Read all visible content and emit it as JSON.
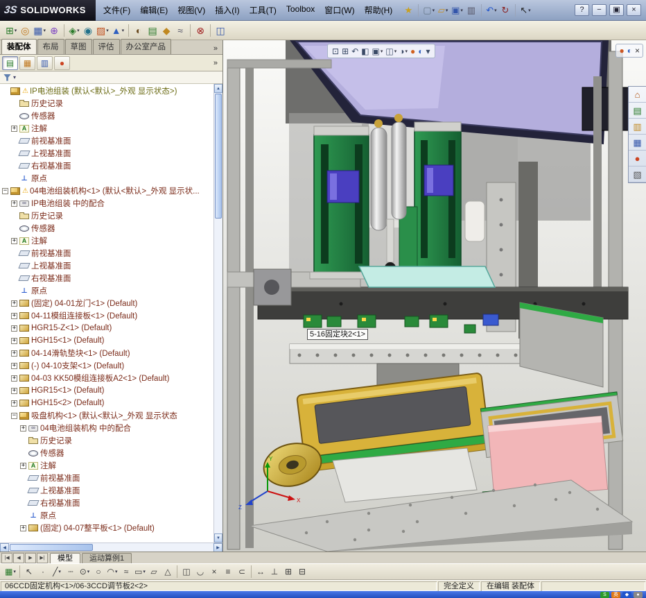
{
  "window": {
    "logo_mark": "3S",
    "logo_text": "SOLIDWORKS",
    "controls": [
      {
        "name": "help-button",
        "glyph": "?"
      },
      {
        "name": "minimize-button",
        "glyph": "−"
      },
      {
        "name": "restore-button",
        "glyph": "▣"
      },
      {
        "name": "close-button",
        "glyph": "×"
      }
    ]
  },
  "menubar": {
    "items": [
      "文件(F)",
      "编辑(E)",
      "视图(V)",
      "插入(I)",
      "工具(T)",
      "Toolbox",
      "窗口(W)",
      "帮助(H)"
    ]
  },
  "toolbar_main": {
    "icons": [
      {
        "name": "pin-icon",
        "glyph": "★",
        "color": "#c8a020"
      },
      {
        "sep": true
      },
      {
        "name": "new-document-icon",
        "glyph": "▢",
        "color": "#667788",
        "caret": true
      },
      {
        "name": "open-icon",
        "glyph": "▱",
        "color": "#c89020",
        "caret": true
      },
      {
        "name": "save-icon",
        "glyph": "▣",
        "color": "#3355aa",
        "caret": true
      },
      {
        "name": "print-icon",
        "glyph": "▥",
        "color": "#555566"
      },
      {
        "sep": true
      },
      {
        "name": "undo-icon",
        "glyph": "↶",
        "color": "#2255cc",
        "caret": true
      },
      {
        "name": "rebuild-icon",
        "glyph": "↻",
        "color": "#8a2020"
      },
      {
        "sep": true
      },
      {
        "name": "select-icon",
        "glyph": "↖",
        "color": "#222222",
        "caret": true
      }
    ]
  },
  "toolbar_assembly": {
    "icons": [
      {
        "name": "insert-components-icon",
        "glyph": "⊞",
        "color": "#2a7a2a",
        "caret": true
      },
      {
        "name": "mate-icon",
        "glyph": "◎",
        "color": "#c07820"
      },
      {
        "name": "linear-component-pattern-icon",
        "glyph": "▦",
        "color": "#3355aa",
        "caret": true
      },
      {
        "name": "smart-fasteners-icon",
        "glyph": "⊕",
        "color": "#7a3fc0"
      },
      {
        "sep": true
      },
      {
        "name": "move-component-icon",
        "glyph": "◈",
        "color": "#2a7a2a",
        "caret": true
      },
      {
        "name": "show-hidden-components-icon",
        "glyph": "◉",
        "color": "#20708a"
      },
      {
        "name": "assembly-features-icon",
        "glyph": "▨",
        "color": "#c05020",
        "caret": true
      },
      {
        "name": "reference-geometry-icon",
        "glyph": "▲",
        "color": "#3060c0",
        "caret": true
      },
      {
        "sep": true
      },
      {
        "name": "new-motion-study-icon",
        "glyph": "◐",
        "color": "#6a4a20"
      },
      {
        "name": "bill-of-materials-icon",
        "glyph": "▤",
        "color": "#2a7a2a"
      },
      {
        "name": "exploded-view-icon",
        "glyph": "◆",
        "color": "#c08820"
      },
      {
        "name": "explode-line-sketch-icon",
        "glyph": "≈",
        "color": "#555566"
      },
      {
        "sep": true
      },
      {
        "name": "interference-detection-icon",
        "glyph": "⊗",
        "color": "#a02020"
      },
      {
        "sep": true
      },
      {
        "name": "window-select-icon",
        "glyph": "◫",
        "color": "#3355aa"
      }
    ]
  },
  "left_panel": {
    "tabs": [
      {
        "label": "装配体",
        "active": true
      },
      {
        "label": "布局"
      },
      {
        "label": "草图"
      },
      {
        "label": "评估"
      },
      {
        "label": "办公室产品"
      }
    ],
    "tabs_overflow": "»",
    "manager_icons": [
      {
        "name": "feature-manager-icon",
        "glyph": "▤",
        "color": "#2a7a2a",
        "active": true
      },
      {
        "name": "property-manager-icon",
        "glyph": "▦",
        "color": "#c07820"
      },
      {
        "name": "configuration-manager-icon",
        "glyph": "▥",
        "color": "#3355aa"
      },
      {
        "name": "display-manager-icon",
        "glyph": "●",
        "color": "#cc4422"
      }
    ],
    "manager_overflow": "»",
    "filter_caret": "▾"
  },
  "feature_tree": {
    "items": [
      {
        "i": 0,
        "ic": "asm",
        "w": true,
        "cls": "root",
        "t": "IP电池组装  (默认<默认>_外观 显示状态>)"
      },
      {
        "i": 1,
        "ic": "hist",
        "t": "历史记录"
      },
      {
        "i": 1,
        "ic": "sens",
        "t": "传感器"
      },
      {
        "i": 1,
        "e": "+",
        "ic": "ann",
        "t": "注解"
      },
      {
        "i": 1,
        "ic": "plane",
        "t": "前视基准面"
      },
      {
        "i": 1,
        "ic": "plane",
        "t": "上视基准面"
      },
      {
        "i": 1,
        "ic": "plane",
        "t": "右视基准面"
      },
      {
        "i": 1,
        "ic": "orig",
        "t": "原点"
      },
      {
        "i": 0,
        "e": "-",
        "ic": "asm",
        "w": true,
        "t": "04电池组装机构<1>  (默认<默认>_外观 显示状..."
      },
      {
        "i": 1,
        "e": "+",
        "ic": "mate",
        "t": "IP电池组装 中的配合"
      },
      {
        "i": 1,
        "ic": "hist",
        "t": "历史记录"
      },
      {
        "i": 1,
        "ic": "sens",
        "t": "传感器"
      },
      {
        "i": 1,
        "e": "+",
        "ic": "ann",
        "t": "注解"
      },
      {
        "i": 1,
        "ic": "plane",
        "t": "前视基准面"
      },
      {
        "i": 1,
        "ic": "plane",
        "t": "上视基准面"
      },
      {
        "i": 1,
        "ic": "plane",
        "t": "右视基准面"
      },
      {
        "i": 1,
        "ic": "orig",
        "t": "原点"
      },
      {
        "i": 1,
        "e": "+",
        "ic": "part",
        "t": "(固定) 04-01龙门<1> (Default)"
      },
      {
        "i": 1,
        "e": "+",
        "ic": "part",
        "t": "04-11模组连接板<1> (Default)"
      },
      {
        "i": 1,
        "e": "+",
        "ic": "part",
        "t": "HGR15-Z<1> (Default)"
      },
      {
        "i": 1,
        "e": "+",
        "ic": "part",
        "t": "HGH15<1> (Default)"
      },
      {
        "i": 1,
        "e": "+",
        "ic": "part",
        "t": "04-14滑轨垫块<1> (Default)"
      },
      {
        "i": 1,
        "e": "+",
        "ic": "part",
        "t": "(-) 04-10支架<1> (Default)"
      },
      {
        "i": 1,
        "e": "+",
        "ic": "part",
        "t": "04-03 KK50模组连接板A2<1> (Default)"
      },
      {
        "i": 1,
        "e": "+",
        "ic": "part",
        "t": "HGR15<1> (Default)"
      },
      {
        "i": 1,
        "e": "+",
        "ic": "part",
        "t": "HGH15<2> (Default)"
      },
      {
        "i": 1,
        "e": "-",
        "ic": "asm",
        "t": "吸盘机构<1>  (默认<默认>_外观 显示状态"
      },
      {
        "i": 2,
        "e": "+",
        "ic": "mate",
        "t": "04电池组装机构 中的配合"
      },
      {
        "i": 2,
        "ic": "hist",
        "t": "历史记录"
      },
      {
        "i": 2,
        "ic": "sens",
        "t": "传感器"
      },
      {
        "i": 2,
        "e": "+",
        "ic": "ann",
        "t": "注解"
      },
      {
        "i": 2,
        "ic": "plane",
        "t": "前视基准面"
      },
      {
        "i": 2,
        "ic": "plane",
        "t": "上视基准面"
      },
      {
        "i": 2,
        "ic": "plane",
        "t": "右视基准面"
      },
      {
        "i": 2,
        "ic": "orig",
        "t": "原点"
      },
      {
        "i": 2,
        "e": "+",
        "ic": "part",
        "t": "(固定) 04-07整平板<1> (Default)"
      }
    ]
  },
  "viewport": {
    "headsup": [
      {
        "name": "zoom-fit-icon",
        "glyph": "⊡"
      },
      {
        "name": "zoom-area-icon",
        "glyph": "⊞"
      },
      {
        "name": "previous-view-icon",
        "glyph": "↶"
      },
      {
        "name": "section-view-icon",
        "glyph": "◧"
      },
      {
        "name": "view-orientation-icon",
        "glyph": "▣",
        "caret": true
      },
      {
        "name": "display-style-icon",
        "glyph": "◫",
        "caret": true
      },
      {
        "name": "hide-show-items-icon",
        "glyph": "◑",
        "caret": true
      },
      {
        "name": "edit-appearance-icon",
        "glyph": "●",
        "color": "#d06020"
      },
      {
        "name": "apply-scene-icon",
        "glyph": "◐",
        "color": "#3060c0"
      },
      {
        "name": "view-settings-icon",
        "glyph": "▾"
      }
    ],
    "topright": [
      {
        "name": "appearance-ball-icon",
        "glyph": "●",
        "color": "#cc5522"
      },
      {
        "name": "scene-icon",
        "glyph": "◐",
        "color": "#3060c0"
      },
      {
        "name": "pane-close-icon",
        "glyph": "×",
        "color": "#333333"
      }
    ],
    "callout": "5-16固定块2<1>",
    "task_pane": [
      {
        "name": "home-icon",
        "glyph": "⌂",
        "color": "#b05010"
      },
      {
        "name": "design-library-icon",
        "glyph": "▤",
        "color": "#2a7a2a"
      },
      {
        "name": "file-explorer-icon",
        "glyph": "▥",
        "color": "#c08820"
      },
      {
        "name": "view-palette-icon",
        "glyph": "▦",
        "color": "#3355aa"
      },
      {
        "name": "appearances-icon",
        "glyph": "●",
        "color": "#cc4422"
      },
      {
        "name": "custom-properties-icon",
        "glyph": "▧",
        "color": "#555555"
      }
    ],
    "triad": {
      "x": "X",
      "y": "Y",
      "z": "Z"
    }
  },
  "bottom": {
    "nav": [
      {
        "name": "first-tab-button",
        "glyph": "|◀"
      },
      {
        "name": "prev-tab-button",
        "glyph": "◀"
      },
      {
        "name": "next-tab-button",
        "glyph": "▶"
      },
      {
        "name": "last-tab-button",
        "glyph": "▶|"
      }
    ],
    "tabs": [
      {
        "label": "模型",
        "active": true
      },
      {
        "label": "运动算例1"
      }
    ]
  },
  "sketchbar": {
    "icons": [
      {
        "name": "sketch-icon",
        "glyph": "▦",
        "color": "#2a7a2a",
        "caret": true
      },
      {
        "sep": true
      },
      {
        "name": "select-tool-icon",
        "glyph": "↖"
      },
      {
        "name": "point-tool-icon",
        "glyph": "·"
      },
      {
        "name": "line-tool-icon",
        "glyph": "╱",
        "caret": true
      },
      {
        "name": "centerline-tool-icon",
        "glyph": "┄"
      },
      {
        "name": "circle-tool-icon",
        "glyph": "⊙",
        "caret": true
      },
      {
        "name": "ellipse-tool-icon",
        "glyph": "○"
      },
      {
        "name": "arc-tool-icon",
        "glyph": "◠",
        "caret": true
      },
      {
        "name": "spline-tool-icon",
        "glyph": "≈"
      },
      {
        "name": "rectangle-tool-icon",
        "glyph": "▭",
        "caret": true
      },
      {
        "name": "parallelogram-tool-icon",
        "glyph": "▱"
      },
      {
        "name": "polygon-tool-icon",
        "glyph": "△"
      },
      {
        "sep": true
      },
      {
        "name": "mirror-entities-icon",
        "glyph": "◫"
      },
      {
        "name": "fillet-tool-icon",
        "glyph": "◡"
      },
      {
        "name": "trim-entities-icon",
        "glyph": "×"
      },
      {
        "name": "offset-entities-icon",
        "glyph": "≡"
      },
      {
        "name": "convert-entities-icon",
        "glyph": "⊂"
      },
      {
        "sep": true
      },
      {
        "name": "smart-dimension-icon",
        "glyph": "↔"
      },
      {
        "name": "add-relation-icon",
        "glyph": "⊥"
      },
      {
        "name": "grid-snap-icon",
        "glyph": "⊞"
      },
      {
        "name": "quick-snaps-icon",
        "glyph": "⊟"
      }
    ]
  },
  "statusbar": {
    "selection": "06CCD固定机构<1>/06-3CCD调节板2<2>",
    "defined": "完全定义",
    "mode": "在编辑 装配体"
  },
  "taskbar": {
    "tray": [
      {
        "name": "solidworks-tray-icon",
        "glyph": "S",
        "bg": "#2a9a2a"
      },
      {
        "name": "ime-tray-icon",
        "glyph": "英",
        "bg": "#e07818"
      },
      {
        "name": "tray-icon-blue",
        "glyph": "◆",
        "bg": "#2255cc"
      },
      {
        "name": "volume-tray-icon",
        "glyph": "●",
        "bg": "#888888"
      }
    ]
  },
  "scrollbars": {
    "up": "▲",
    "down": "▼",
    "left": "◀",
    "right": "▶"
  }
}
